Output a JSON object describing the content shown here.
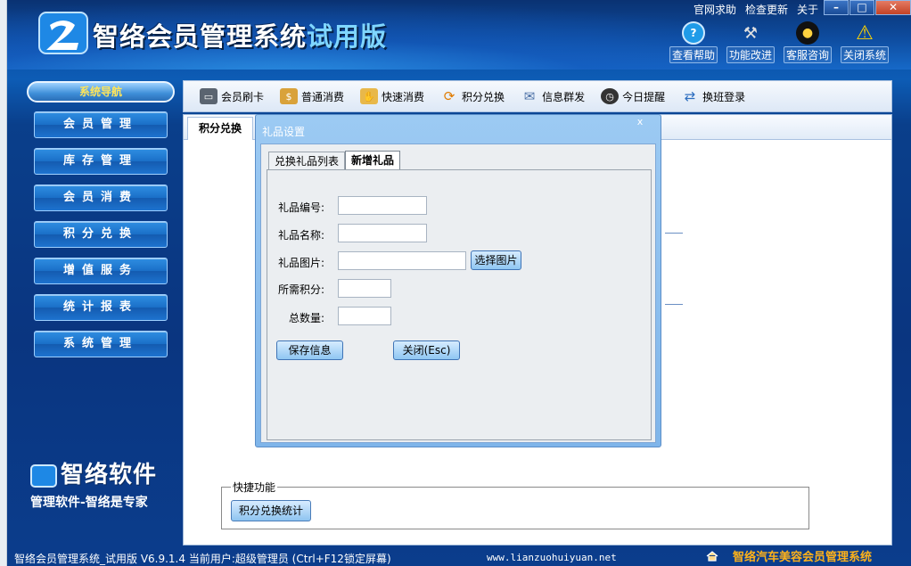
{
  "app": {
    "title_main": "智络会员管理系统",
    "title_trial": "试用版",
    "top_links": [
      "官网求助",
      "检查更新",
      "关于"
    ],
    "window_controls": [
      "–",
      "□",
      "✕"
    ],
    "top_buttons": [
      {
        "label": "查看帮助",
        "icon": "help-icon"
      },
      {
        "label": "功能改进",
        "icon": "tools-icon"
      },
      {
        "label": "客服咨询",
        "icon": "penguin-icon"
      },
      {
        "label": "关闭系统",
        "icon": "warning-icon"
      }
    ]
  },
  "nav": {
    "header": "系统导航",
    "items": [
      "会员管理",
      "库存管理",
      "会员消费",
      "积分兑换",
      "增值服务",
      "统计报表",
      "系统管理"
    ]
  },
  "toolbar": {
    "items": [
      {
        "label": "会员刷卡",
        "icon": "card-icon"
      },
      {
        "label": "普通消费",
        "icon": "coin-bag-icon"
      },
      {
        "label": "快速消费",
        "icon": "hand-coins-icon"
      },
      {
        "label": "积分兑换",
        "icon": "exchange-icon"
      },
      {
        "label": "信息群发",
        "icon": "envelope-icon"
      },
      {
        "label": "今日提醒",
        "icon": "clock-icon"
      },
      {
        "label": "换班登录",
        "icon": "shift-icon"
      }
    ]
  },
  "main": {
    "active_tab": "积分兑换",
    "quick": {
      "legend": "快捷功能",
      "button": "积分兑换统计"
    }
  },
  "dialog": {
    "title": "礼品设置",
    "close": "x",
    "tabs": [
      "兑换礼品列表",
      "新增礼品"
    ],
    "active_tab": 1,
    "fields": {
      "code_label": "礼品编号:",
      "name_label": "礼品名称:",
      "image_label": "礼品图片:",
      "points_label": "所需积分:",
      "qty_label": "总数量:",
      "code_value": "",
      "name_value": "",
      "image_value": "",
      "points_value": "",
      "qty_value": ""
    },
    "select_image_button": "选择图片",
    "save_button": "保存信息",
    "close_button": "关闭(Esc)"
  },
  "brand": {
    "name": "智络软件",
    "slogan": "管理软件-智络是专家"
  },
  "status": {
    "left": "智络会员管理系统_试用版 V6.9.1.4 当前用户:超级管理员 (Ctrl+F12锁定屏幕)",
    "url": "www.lianzuohuiyuan.net",
    "right": "智络汽车美容会员管理系统"
  }
}
